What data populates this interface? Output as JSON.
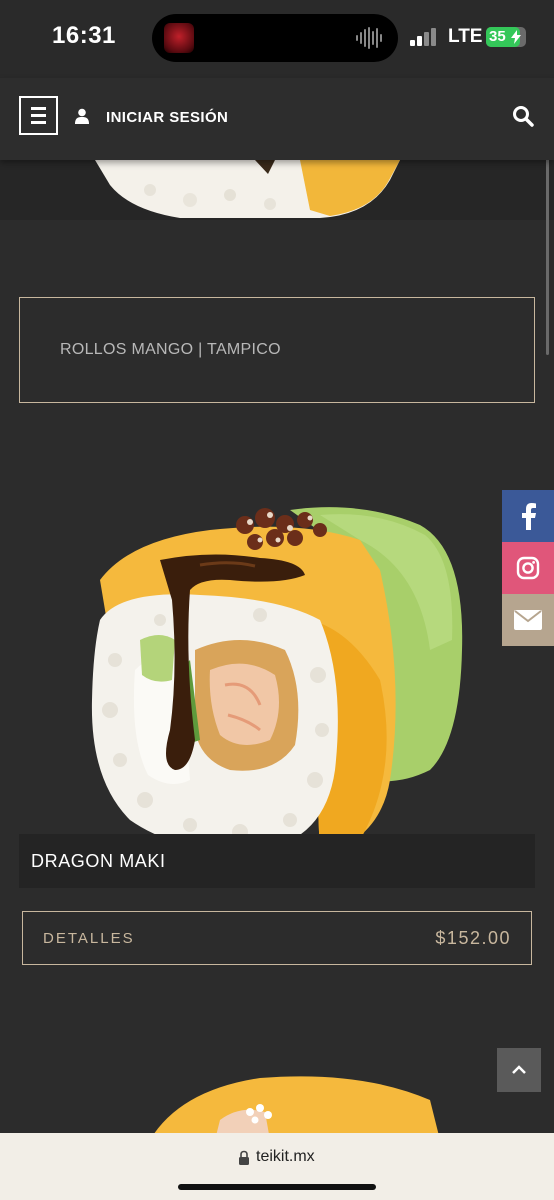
{
  "status_bar": {
    "time": "16:31",
    "network": "LTE",
    "battery": "35"
  },
  "header": {
    "login_label": "INICIAR SESIÓN",
    "menu_icon": "hamburger-icon",
    "user_icon": "user-icon",
    "search_icon": "search-icon"
  },
  "category": {
    "label": "ROLLOS MANGO | TAMPICO"
  },
  "product": {
    "name": "DRAGON MAKI",
    "details_label": "DETALLES",
    "price": "$152.00"
  },
  "social": {
    "facebook_color": "#3b5998",
    "instagram_color": "#e0567a",
    "mail_color": "#b6a58f"
  },
  "browser": {
    "url": "teikit.mx"
  },
  "colors": {
    "accent": "#c8b79e",
    "background": "#2c2c2c"
  }
}
